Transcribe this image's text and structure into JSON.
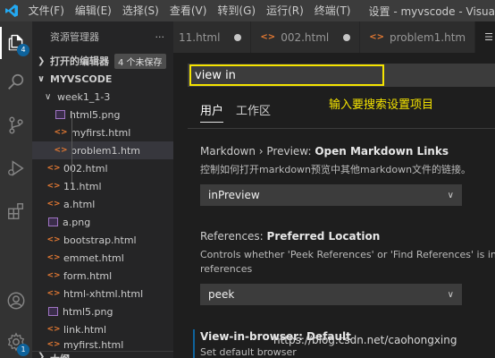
{
  "titlebar": {
    "menu": [
      "文件(F)",
      "编辑(E)",
      "选择(S)",
      "查看(V)",
      "转到(G)",
      "运行(R)",
      "终端(T)"
    ],
    "title": "设置 - myvscode - Visua"
  },
  "activity": {
    "explorer_badge": "4",
    "accounts_badge": "1"
  },
  "sidebar": {
    "header": "资源管理器",
    "more": "···",
    "open_editors": "打开的编辑器",
    "unsaved_badge": "4 个未保存",
    "workspace": "MYVSCODE",
    "folder": "week1_1-3",
    "folder_items": [
      {
        "name": "html5.png",
        "type": "img"
      },
      {
        "name": "myfirst.html",
        "type": "html"
      },
      {
        "name": "problem1.htm",
        "type": "html"
      }
    ],
    "items": [
      {
        "name": "002.html",
        "type": "html"
      },
      {
        "name": "11.html",
        "type": "html"
      },
      {
        "name": "a.html",
        "type": "html"
      },
      {
        "name": "a.png",
        "type": "img"
      },
      {
        "name": "bootstrap.html",
        "type": "html"
      },
      {
        "name": "emmet.html",
        "type": "html"
      },
      {
        "name": "form.html",
        "type": "html"
      },
      {
        "name": "html-xhtml.html",
        "type": "html"
      },
      {
        "name": "html5.png",
        "type": "img"
      },
      {
        "name": "link.html",
        "type": "html"
      },
      {
        "name": "myfirst.html",
        "type": "html"
      }
    ],
    "bottom": "大纲"
  },
  "tabs": [
    {
      "label": "11.html"
    },
    {
      "label": "002.html"
    },
    {
      "label": "problem1.htm"
    },
    {
      "label": "设"
    }
  ],
  "settings": {
    "search_value": "view in",
    "hint": "输入要搜索设置项目",
    "scope_user": "用户",
    "scope_workspace": "工作区",
    "s1_prefix": "Markdown › Preview: ",
    "s1_title": "Open Markdown Links",
    "s1_desc": "控制如何打开markdown预览中其他markdown文件的链接。",
    "s1_value": "inPreview",
    "s2_prefix": "References: ",
    "s2_title": "Preferred Location",
    "s2_desc1": "Controls whether 'Peek References' or 'Find References' is invok",
    "s2_desc2": "references",
    "s2_value": "peek",
    "s3_title": "View-in-browser: Default",
    "s3_desc": "Set default browser"
  },
  "watermark": "https://blog.csdn.net/caohongxing",
  "colors": {
    "highlight": "#f5e400",
    "accent": "#0e639c"
  }
}
